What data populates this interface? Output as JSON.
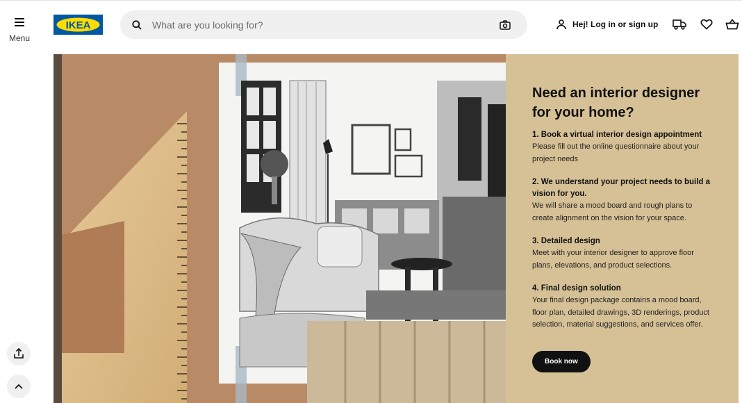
{
  "nav": {
    "menu_label": "Menu"
  },
  "logo": {
    "text": "IKEA"
  },
  "search": {
    "placeholder": "What are you looking for?",
    "value": ""
  },
  "account": {
    "login_label": "Hej! Log in or sign up"
  },
  "icons": {
    "menu": "hamburger-icon",
    "search": "search-icon",
    "camera": "camera-icon",
    "user": "user-icon",
    "delivery": "delivery-truck-icon",
    "wishlist": "heart-icon",
    "cart": "shopping-bag-icon",
    "share": "share-icon",
    "scroll_top": "chevron-up-icon"
  },
  "promo": {
    "title": "Need an interior designer for your home?",
    "steps": [
      {
        "title": "1. Book a virtual interior design appointment",
        "desc": "Please fill out the online questionnaire about your project needs"
      },
      {
        "title": "2. We understand your project needs to build a vision for you.",
        "desc": "We will share a mood board and rough plans to create alignment on the vision for your space."
      },
      {
        "title": "3. Detailed design",
        "desc": "Meet with your interior designer to approve floor plans, elevations, and product selections."
      },
      {
        "title": "4. Final design solution",
        "desc": "Your final design package contains a mood board, floor plan, detailed drawings, 3D renderings, product selection, material suggestions, and services offer."
      }
    ],
    "cta_label": "Book now"
  },
  "colors": {
    "panel_bg": "#d6c196",
    "hero_bg": "#b98a66",
    "logo_blue": "#0058a3",
    "logo_yellow": "#ffdb00",
    "button_bg": "#111111"
  }
}
